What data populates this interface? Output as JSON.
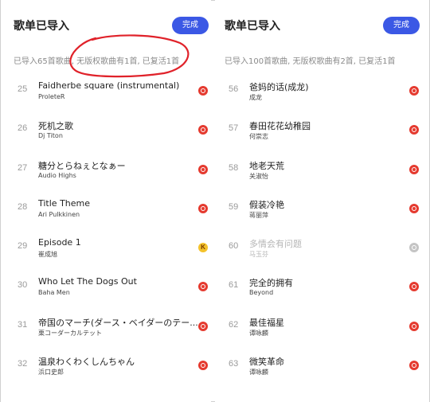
{
  "left": {
    "title": "歌单已导入",
    "done_label": "完成",
    "summary": "已导入65首歌曲, 无版权歌曲有1首, 已复活1首",
    "songs": [
      {
        "num": "25",
        "name": "Faidherbe square (instrumental)",
        "artist": "ProleteR",
        "source": "netease-icon",
        "disabled": false
      },
      {
        "num": "26",
        "name": "死机之歌",
        "artist": "Dj Titon",
        "source": "netease-icon",
        "disabled": false
      },
      {
        "num": "27",
        "name": "糖分とらねぇとなぁー",
        "artist": "Audio Highs",
        "source": "netease-icon",
        "disabled": false
      },
      {
        "num": "28",
        "name": "Title Theme",
        "artist": "Ari Pulkkinen",
        "source": "netease-icon",
        "disabled": false
      },
      {
        "num": "29",
        "name": "Episode 1",
        "artist": "崔成旭",
        "source": "kuwo-icon",
        "disabled": false
      },
      {
        "num": "30",
        "name": "Who Let The Dogs Out",
        "artist": "Baha Men",
        "source": "netease-icon",
        "disabled": false
      },
      {
        "num": "31",
        "name": "帝国のマーチ(ダース・ベイダーのテー...",
        "artist": "栗コーダーカルテット",
        "source": "netease-icon",
        "disabled": false
      },
      {
        "num": "32",
        "name": "温泉わくわくしんちゃん",
        "artist": "浜口史郎",
        "source": "netease-icon",
        "disabled": false
      }
    ]
  },
  "right": {
    "title": "歌单已导入",
    "done_label": "完成",
    "summary": "已导入100首歌曲, 无版权歌曲有2首, 已复活1首",
    "songs": [
      {
        "num": "56",
        "name": "爸妈的话(成龙)",
        "artist": "成龙",
        "source": "netease-icon",
        "disabled": false
      },
      {
        "num": "57",
        "name": "春田花花幼稚园",
        "artist": "何崇志",
        "source": "netease-icon",
        "disabled": false
      },
      {
        "num": "58",
        "name": "地老天荒",
        "artist": "关淑怡",
        "source": "netease-icon",
        "disabled": false
      },
      {
        "num": "59",
        "name": "假装冷艳",
        "artist": "蒋丽萍",
        "source": "netease-icon",
        "disabled": false
      },
      {
        "num": "60",
        "name": "多情会有问题",
        "artist": "马玉芬",
        "source": "unavailable-icon",
        "disabled": true
      },
      {
        "num": "61",
        "name": "完全的拥有",
        "artist": "Beyond",
        "source": "netease-icon",
        "disabled": false
      },
      {
        "num": "62",
        "name": "最佳福星",
        "artist": "谭咏麟",
        "source": "netease-icon",
        "disabled": false
      },
      {
        "num": "63",
        "name": "微笑革命",
        "artist": "谭咏麟",
        "source": "netease-icon",
        "disabled": false
      }
    ]
  },
  "colors": {
    "accent": "#3b58e5",
    "annotation": "#e0222a",
    "netease": "#e53a2f",
    "kuwo": "#f4c22b"
  }
}
